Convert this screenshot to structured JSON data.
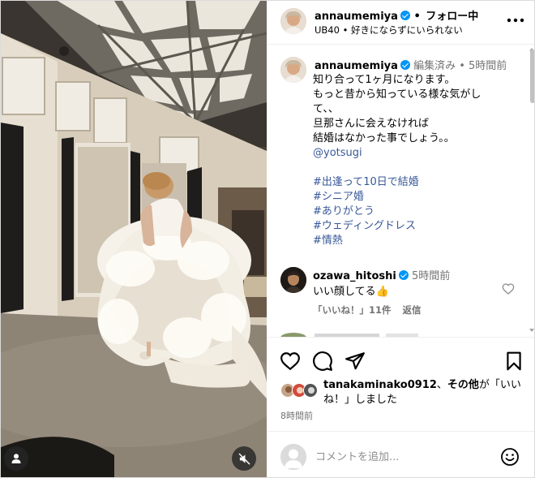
{
  "post": {
    "author": "annaumemiya",
    "follow_separator": "•",
    "follow_status": "フォロー中",
    "subtitle": "UB40 • 好きにならずにいられない",
    "caption": {
      "author": "annaumemiya",
      "edited": "編集済み",
      "separator": "•",
      "time": "5時間前",
      "lines": [
        "知り合って1ヶ月になります。",
        "もっと昔から知っている様な気がし",
        "て、、",
        "旦那さんに会えなければ",
        "結婚はなかった事でしょう。。"
      ],
      "mention": "@yotsugi",
      "hashtags": [
        "#出逢って10日で結婚",
        "#シニア婚",
        "#ありがとう",
        "#ウェディングドレス",
        "#情熱"
      ]
    },
    "comment": {
      "author": "ozawa_hitoshi",
      "time": "5時間前",
      "text": "いい顔してる👍",
      "likes": "「いいね！」11件",
      "reply": "返信"
    },
    "likes_line": {
      "user": "tanakaminako0912",
      "sep": "、",
      "others": "その他",
      "rest": "が「いいね！」しました"
    },
    "posted": "8時間前",
    "composer": {
      "placeholder": "コメントを追加..."
    }
  },
  "icons": {
    "more": "more-horizontal-icon",
    "heart": "heart-icon",
    "comment": "comment-icon",
    "share": "share-icon",
    "save": "bookmark-icon",
    "emoji": "emoji-icon",
    "mute": "mute-icon",
    "user": "user-icon"
  },
  "colors": {
    "verified": "#0095f6",
    "link": "#385898",
    "muted": "#737373"
  }
}
